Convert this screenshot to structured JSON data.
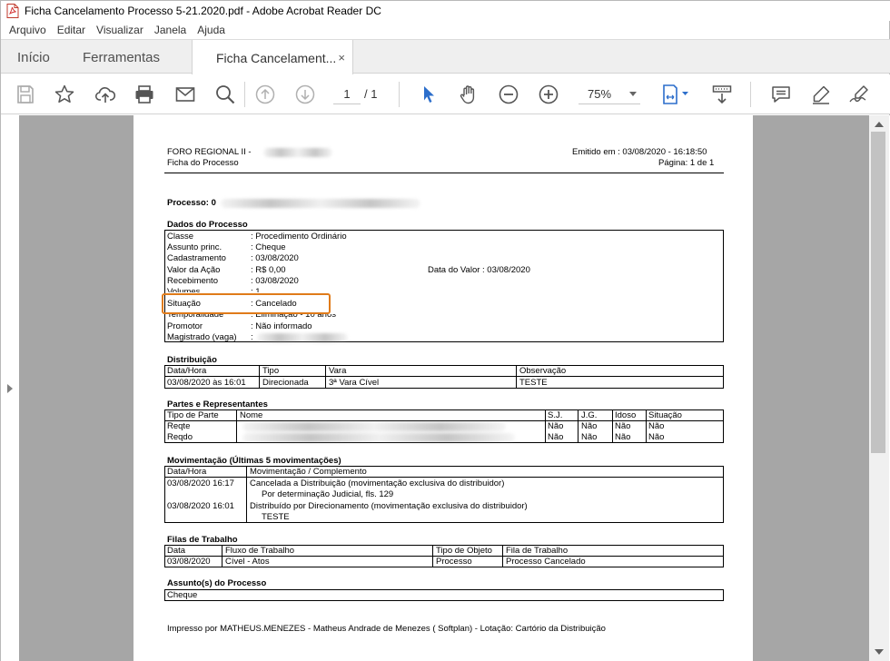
{
  "window": {
    "title": "Ficha Cancelamento Processo 5-21.2020.pdf - Adobe Acrobat Reader DC"
  },
  "menu": [
    "Arquivo",
    "Editar",
    "Visualizar",
    "Janela",
    "Ajuda"
  ],
  "tabs": {
    "home": "Início",
    "tools": "Ferramentas",
    "document": "Ficha Cancelament...",
    "close": "×"
  },
  "toolbar": {
    "page_current": "1",
    "page_total": "/  1",
    "zoom": "75%"
  },
  "doc": {
    "header": {
      "forum": "FORO REGIONAL II -",
      "subtitle": "Ficha do Processo",
      "emitted": "Emitido em : 03/08/2020 - 16:18:50",
      "page": "Página: 1 de 1"
    },
    "process_label": "Processo: 0",
    "dados": {
      "title": "Dados do Processo",
      "rows": [
        {
          "label": "Classe",
          "value": ": Procedimento Ordinário"
        },
        {
          "label": "Assunto princ.",
          "value": ": Cheque"
        },
        {
          "label": "Cadastramento",
          "value": ": 03/08/2020"
        },
        {
          "label": "Valor da Ação",
          "value": ": R$ 0,00"
        },
        {
          "label": "Recebimento",
          "value": ": 03/08/2020"
        },
        {
          "label": "Volumes",
          "value": ": 1"
        },
        {
          "label": "Situação",
          "value": ": Cancelado"
        },
        {
          "label": "Temporalidade",
          "value": ": Eliminação - 10 anos"
        },
        {
          "label": "Promotor",
          "value": ": Não informado"
        },
        {
          "label": "Magistrado (vaga)",
          "value": ":"
        }
      ],
      "data_valor": "Data do Valor     : 03/08/2020"
    },
    "distribuicao": {
      "title": "Distribuição",
      "headers": [
        "Data/Hora",
        "Tipo",
        "Vara",
        "Observação"
      ],
      "row": [
        "03/08/2020 às 16:01",
        "Direcionada",
        "3ª Vara Cível",
        "TESTE"
      ]
    },
    "partes": {
      "title": "Partes e Representantes",
      "headers": [
        "Tipo de Parte",
        "Nome",
        "S.J.",
        "J.G.",
        "Idoso",
        "Situação"
      ],
      "rows": [
        [
          "Reqte",
          "",
          "Não",
          "Não",
          "Não",
          "Não"
        ],
        [
          "Reqdo",
          "",
          "Não",
          "Não",
          "Não",
          "Não"
        ]
      ]
    },
    "movimentacao": {
      "title": "Movimentação (Últimas 5 movimentações)",
      "headers": [
        "Data/Hora",
        "Movimentação / Complemento"
      ],
      "rows": [
        {
          "date": "03/08/2020 16:17",
          "text": "Cancelada a Distribuição (movimentação exclusiva do distribuidor)",
          "sub": "Por determinação Judicial, fls. 129"
        },
        {
          "date": "03/08/2020 16:01",
          "text": "Distribuído por Direcionamento (movimentação exclusiva do distribuidor)",
          "sub": "TESTE"
        }
      ]
    },
    "filas": {
      "title": "Filas de Trabalho",
      "headers": [
        "Data",
        "Fluxo de Trabalho",
        "Tipo de Objeto",
        "Fila de Trabalho"
      ],
      "row": [
        "03/08/2020",
        "Cível - Atos",
        "Processo",
        "Processo Cancelado"
      ]
    },
    "assuntos": {
      "title": "Assunto(s) do Processo",
      "value": "Cheque"
    },
    "footer": "Impresso por MATHEUS.MENEZES - Matheus Andrade de Menezes ( Softplan) - Lotação: Cartório da Distribuição"
  },
  "colors": {
    "highlight": "#e07b1a",
    "accent": "#2c6ecb",
    "doc_background": "#a6a6a6"
  }
}
